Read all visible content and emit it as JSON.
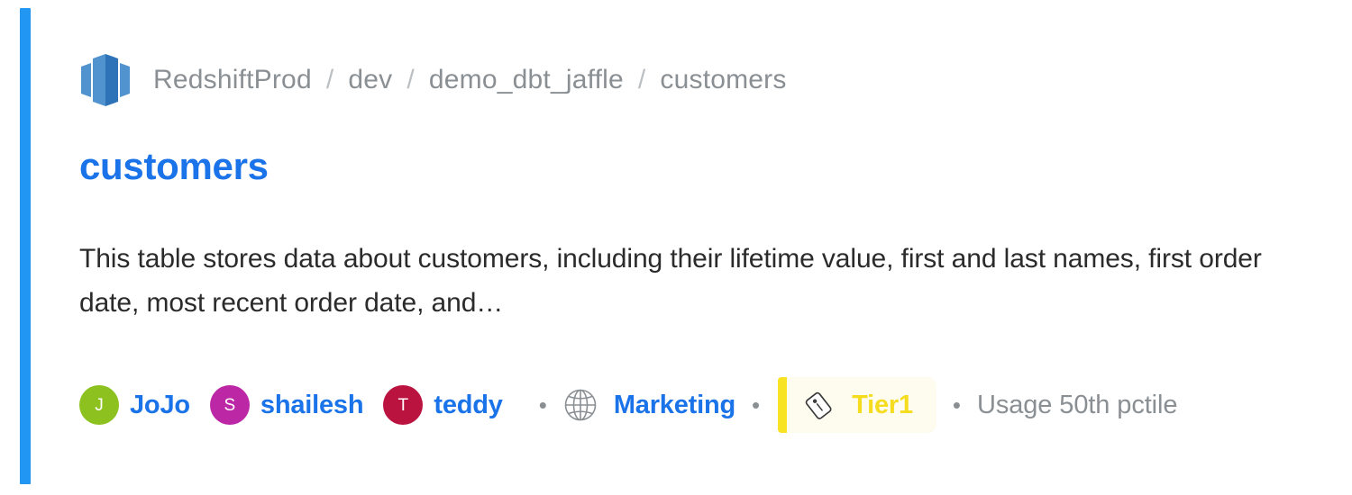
{
  "accent_color": "#2196f3",
  "source": {
    "icon": "aws-redshift-icon",
    "platform": "RedshiftProd"
  },
  "breadcrumb": {
    "separator": "/",
    "items": [
      "RedshiftProd",
      "dev",
      "demo_dbt_jaffle",
      "customers"
    ]
  },
  "title": "customers",
  "description": "This table stores data about customers, including their lifetime value, first and last names, first order date, most recent order date, and…",
  "meta": {
    "separator": "•",
    "owners": [
      {
        "initial": "J",
        "name": "JoJo",
        "color": "#8cc11f"
      },
      {
        "initial": "S",
        "name": "shailesh",
        "color": "#bc27a6"
      },
      {
        "initial": "T",
        "name": "teddy",
        "color": "#bb1340"
      }
    ],
    "domain": {
      "icon": "globe-icon",
      "label": "Marketing"
    },
    "tag": {
      "icon": "tag-icon",
      "label": "Tier1",
      "color": "#f6dc1e",
      "background": "#fdfcef",
      "border_color": "#f7e324"
    },
    "usage": "Usage 50th pctile"
  }
}
